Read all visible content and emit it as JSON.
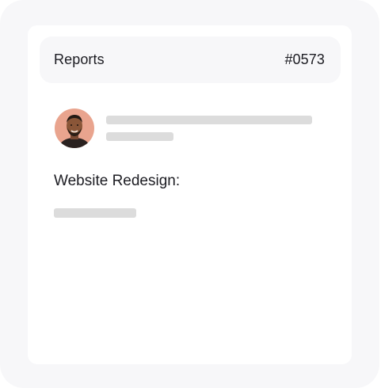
{
  "header": {
    "title": "Reports",
    "id": "#0573"
  },
  "body": {
    "section_title": "Website Redesign:"
  },
  "colors": {
    "outer_background": "#f7f7f9",
    "card_background": "#ffffff",
    "header_background": "#f7f7f9",
    "skeleton": "#dcdcdc",
    "text": "#1c1c22"
  }
}
